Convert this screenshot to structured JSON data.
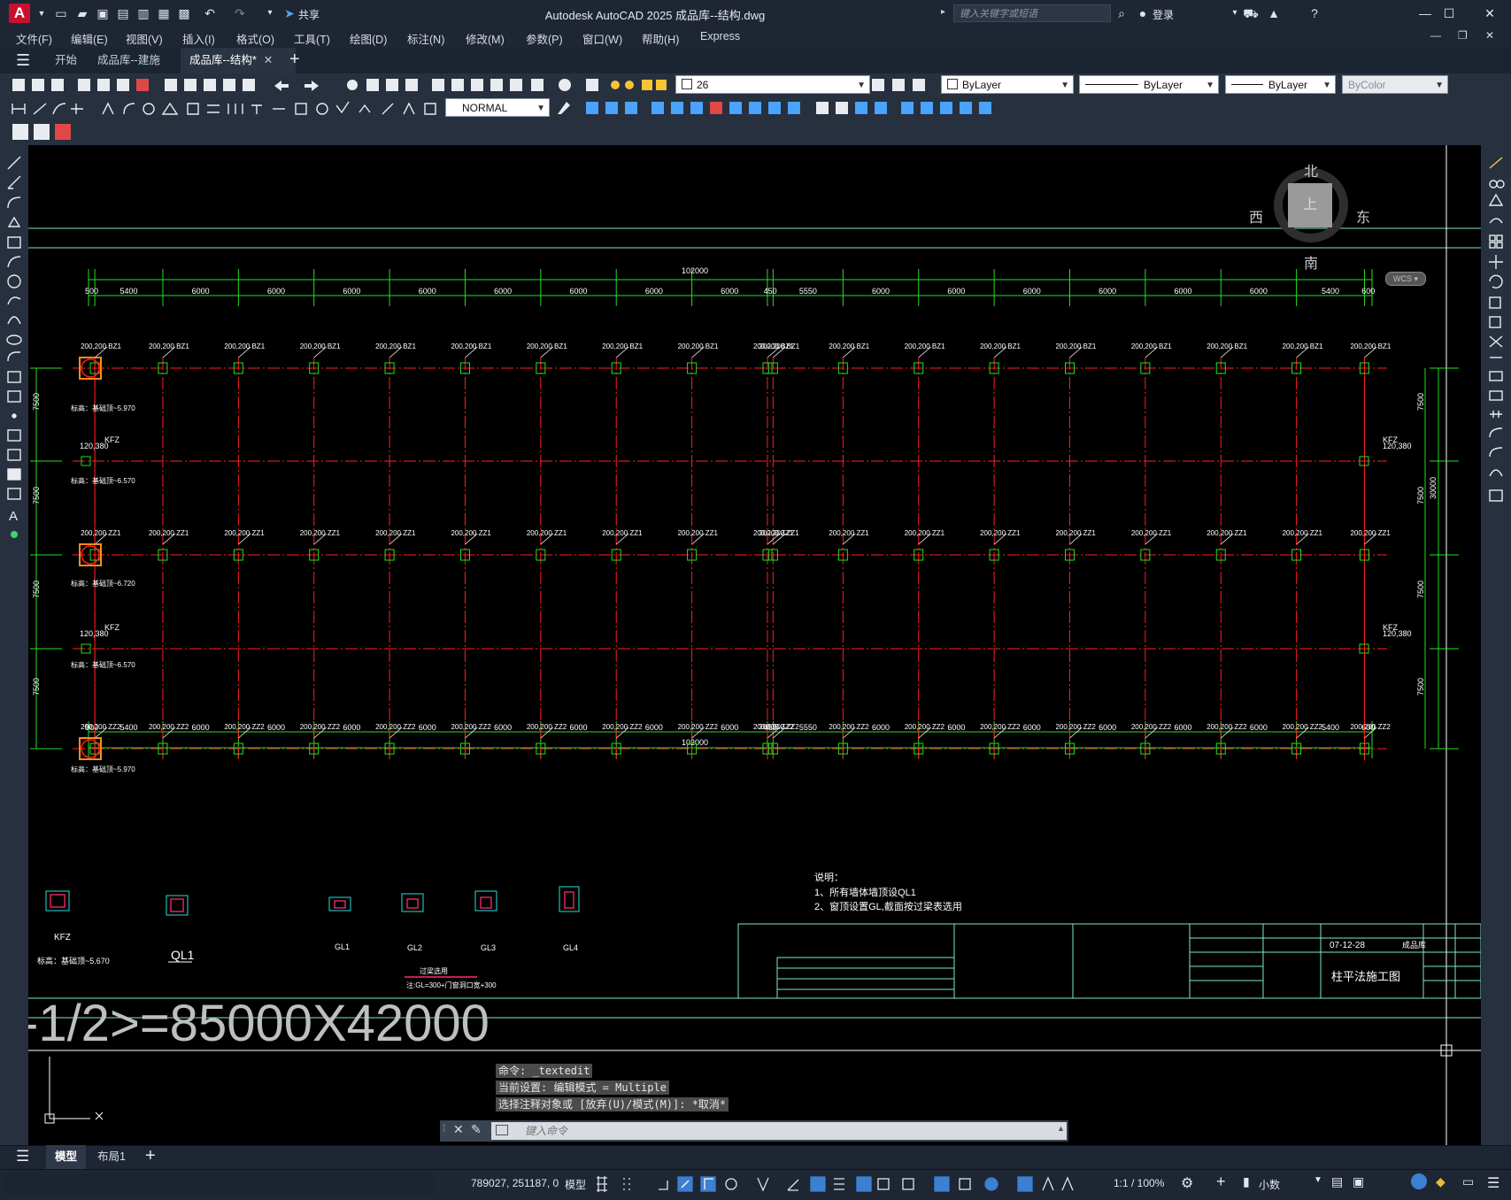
{
  "app": {
    "logo": "A",
    "title": "Autodesk AutoCAD 2025    成品库--结构.dwg",
    "share_label": "共享",
    "search_placeholder": "键入关键字或短语",
    "login_label": "登录"
  },
  "menu": [
    "文件(F)",
    "编辑(E)",
    "视图(V)",
    "插入(I)",
    "格式(O)",
    "工具(T)",
    "绘图(D)",
    "标注(N)",
    "修改(M)",
    "参数(P)",
    "窗口(W)",
    "帮助(H)",
    "Express"
  ],
  "tabs": [
    {
      "label": "开始"
    },
    {
      "label": "成品库--建施"
    },
    {
      "label": "成品库--结构*"
    }
  ],
  "toolbar": {
    "layer_value": "26",
    "color_value": "ByLayer",
    "linetype_value": "ByLayer",
    "lineweight_value": "ByLayer",
    "plotstyle_value": "ByColor",
    "dimstyle_value": "NORMAL"
  },
  "viewcube": {
    "north": "北",
    "south": "南",
    "east": "东",
    "west": "西",
    "top": "上",
    "wcs": "WCS"
  },
  "drawing": {
    "top_dims": [
      "500",
      "5400",
      "6000",
      "6000",
      "6000",
      "6000",
      "6000",
      "6000",
      "6000",
      "6000",
      "450",
      "5550",
      "6000",
      "6000",
      "6000",
      "6000",
      "6000",
      "6000",
      "5400",
      "600"
    ],
    "total_dim": "102000",
    "side_dims": [
      "7500",
      "7500",
      "7500",
      "7500"
    ],
    "side_total": "30000",
    "row1_label": "200,200 BZ1",
    "row2_label": "200,200 ZZ1",
    "row3_label": "200,200 ZZ2",
    "kfz_label": "KFZ",
    "kfz_dim": "120,380",
    "elev1": "标高：基础顶~5.970",
    "elev2": "标高：基础顶~6.570",
    "elev3": "标高：基础顶~6.720",
    "elev4": "标高：基础顶~6.570",
    "elev5": "标高：基础顶~5.970",
    "notes_title": "说明：",
    "note1": "1、所有墙体墙顶设QL1",
    "note2": "2、窗顶设置GL,截面按过梁表选用",
    "details": [
      "KFZ",
      "QL1",
      "GL1",
      "GL2",
      "GL3",
      "GL4"
    ],
    "detail_kfz_elev": "标高：基础顶~5.670",
    "gl_note": "注:GL=300+门窗洞口宽+300",
    "gl_table_title": "过梁选用",
    "titleblock_title": "柱平法施工图",
    "titleblock_project": "成品库",
    "titleblock_date": "07-12-28",
    "big_text": "-1/2>=85000X42000"
  },
  "command": {
    "line1": "命令:  _textedit",
    "line2": "当前设置: 编辑模式 = Multiple",
    "line3": "选择注释对象或 [放弃(U)/模式(M)]: *取消*",
    "input_placeholder": "键入命令"
  },
  "layout_tabs": [
    "模型",
    "布局1"
  ],
  "status": {
    "coords": "789027, 251187, 0",
    "model": "模型",
    "scale": "1:1 / 100%",
    "units": "小数"
  }
}
